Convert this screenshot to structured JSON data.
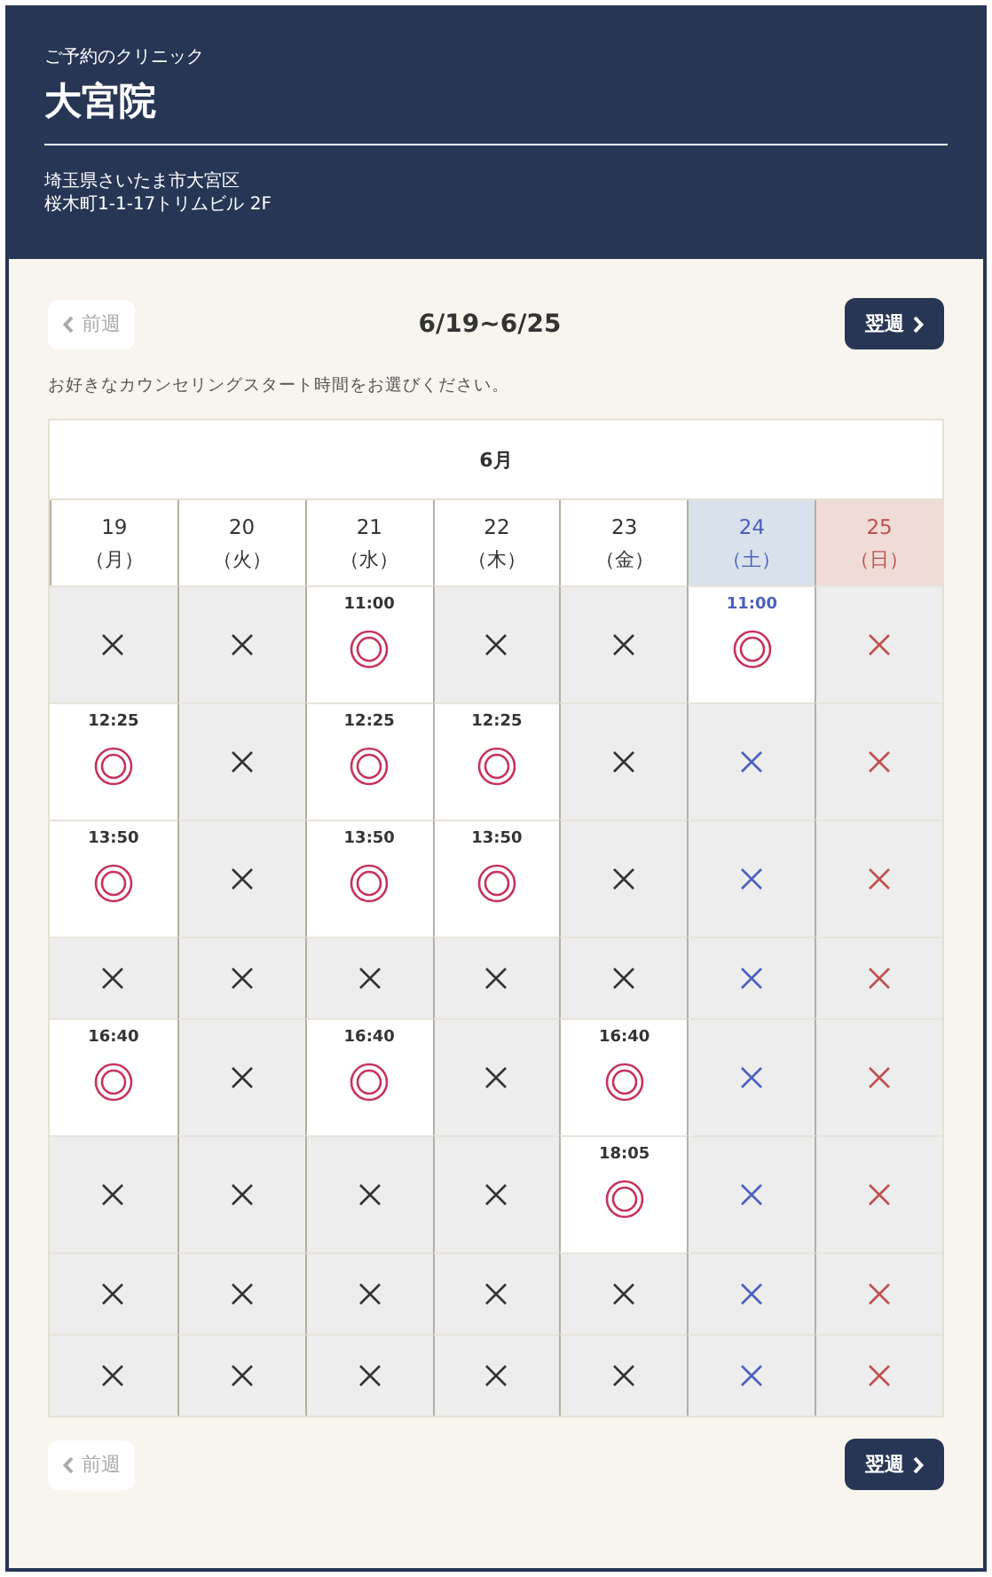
{
  "clinic": {
    "label": "ご予約のクリニック",
    "name": "大宮院",
    "address": [
      "埼玉県さいたま市大宮区",
      "桜木町1-1-17トリムビル 2F"
    ]
  },
  "nav_top": {
    "prev": {
      "label": "前週",
      "disabled": true
    },
    "range": "6/19~6/25",
    "next": {
      "label": "翌週",
      "disabled": false
    }
  },
  "instruction": "お好きなカウンセリングスタート時間をお選びください。",
  "calendar": {
    "month": "6月",
    "days": [
      {
        "day": "19",
        "weekday": "（月）",
        "kind": "weekday"
      },
      {
        "day": "20",
        "weekday": "（火）",
        "kind": "weekday"
      },
      {
        "day": "21",
        "weekday": "（水）",
        "kind": "weekday"
      },
      {
        "day": "22",
        "weekday": "（木）",
        "kind": "weekday"
      },
      {
        "day": "23",
        "weekday": "（金）",
        "kind": "weekday"
      },
      {
        "day": "24",
        "weekday": "（土）",
        "kind": "saturday"
      },
      {
        "day": "25",
        "weekday": "（日）",
        "kind": "sunday"
      }
    ],
    "rows": [
      [
        {
          "available": false
        },
        {
          "available": false
        },
        {
          "available": true,
          "time": "11:00"
        },
        {
          "available": false
        },
        {
          "available": false
        },
        {
          "available": true,
          "time": "11:00"
        },
        {
          "available": false
        }
      ],
      [
        {
          "available": true,
          "time": "12:25"
        },
        {
          "available": false
        },
        {
          "available": true,
          "time": "12:25"
        },
        {
          "available": true,
          "time": "12:25"
        },
        {
          "available": false
        },
        {
          "available": false
        },
        {
          "available": false
        }
      ],
      [
        {
          "available": true,
          "time": "13:50"
        },
        {
          "available": false
        },
        {
          "available": true,
          "time": "13:50"
        },
        {
          "available": true,
          "time": "13:50"
        },
        {
          "available": false
        },
        {
          "available": false
        },
        {
          "available": false
        }
      ],
      [
        {
          "available": false
        },
        {
          "available": false
        },
        {
          "available": false
        },
        {
          "available": false
        },
        {
          "available": false
        },
        {
          "available": false
        },
        {
          "available": false
        }
      ],
      [
        {
          "available": true,
          "time": "16:40"
        },
        {
          "available": false
        },
        {
          "available": true,
          "time": "16:40"
        },
        {
          "available": false
        },
        {
          "available": true,
          "time": "16:40"
        },
        {
          "available": false
        },
        {
          "available": false
        }
      ],
      [
        {
          "available": false
        },
        {
          "available": false
        },
        {
          "available": false
        },
        {
          "available": false
        },
        {
          "available": true,
          "time": "18:05"
        },
        {
          "available": false
        },
        {
          "available": false
        }
      ],
      [
        {
          "available": false
        },
        {
          "available": false
        },
        {
          "available": false
        },
        {
          "available": false
        },
        {
          "available": false
        },
        {
          "available": false
        },
        {
          "available": false
        }
      ],
      [
        {
          "available": false
        },
        {
          "available": false
        },
        {
          "available": false
        },
        {
          "available": false
        },
        {
          "available": false
        },
        {
          "available": false
        },
        {
          "available": false
        }
      ]
    ]
  },
  "nav_bottom": {
    "prev": {
      "label": "前週",
      "disabled": true
    },
    "next": {
      "label": "翌週",
      "disabled": false
    }
  }
}
